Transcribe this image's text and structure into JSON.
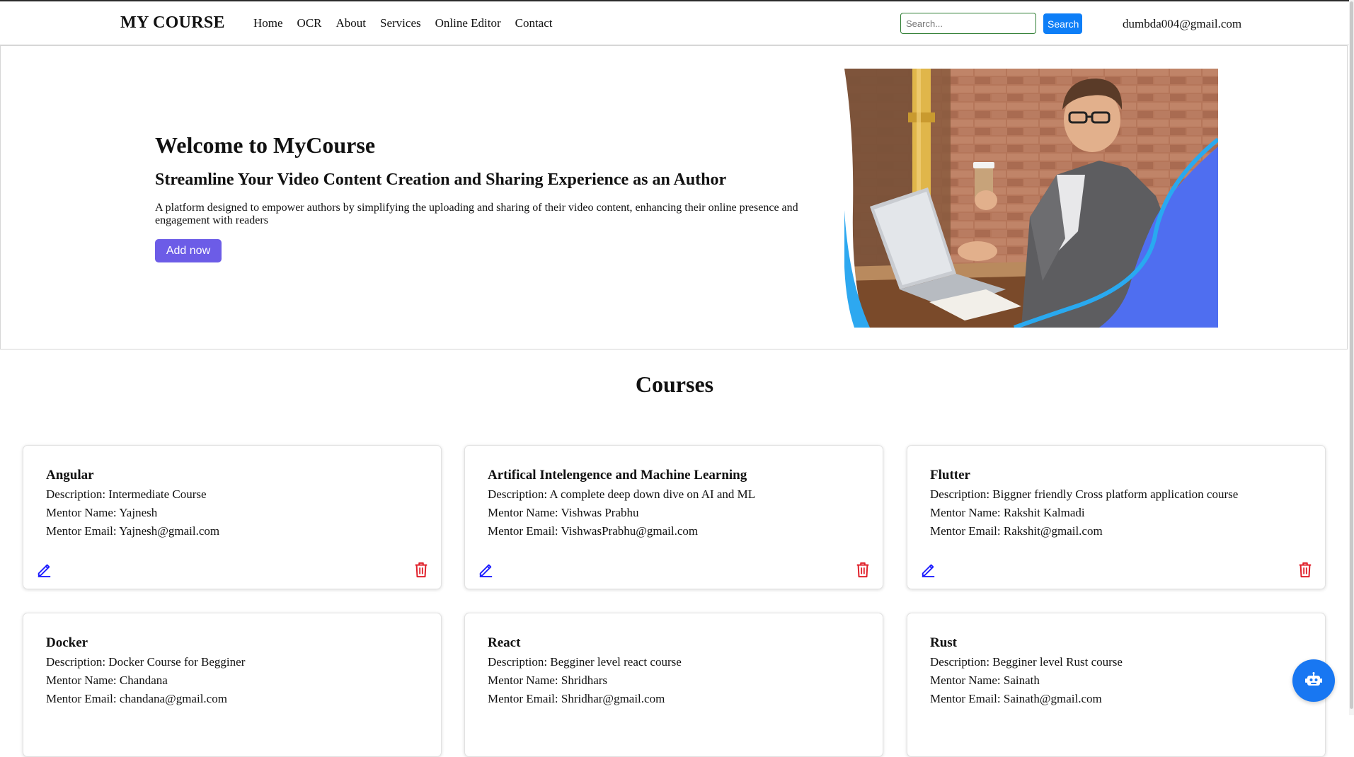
{
  "navbar": {
    "brand": "MY COURSE",
    "links": [
      "Home",
      "OCR",
      "About",
      "Services",
      "Online Editor",
      "Contact"
    ],
    "search_placeholder": "Search...",
    "search_button": "Search",
    "user_email": "dumbda004@gmail.com"
  },
  "hero": {
    "title": "Welcome to MyCourse",
    "subtitle": "Streamline Your Video Content Creation and Sharing Experience as an Author",
    "description": "A platform designed to empower authors by simplifying the uploading and sharing of their video content, enhancing their online presence and engagement with readers",
    "add_button": "Add now"
  },
  "courses": {
    "heading": "Courses",
    "items": [
      {
        "title": "Angular",
        "description": "Description: Intermediate Course",
        "mentor_name": "Mentor Name: Yajnesh",
        "mentor_email": "Mentor Email: Yajnesh@gmail.com"
      },
      {
        "title": "Artifical Intelengence and Machine Learning",
        "description": "Description: A complete deep down dive on AI and ML",
        "mentor_name": "Mentor Name: Vishwas Prabhu",
        "mentor_email": "Mentor Email: VishwasPrabhu@gmail.com"
      },
      {
        "title": "Flutter",
        "description": "Description: Biggner friendly Cross platform application course",
        "mentor_name": "Mentor Name: Rakshit Kalmadi",
        "mentor_email": "Mentor Email: Rakshit@gmail.com"
      },
      {
        "title": "Docker",
        "description": "Description: Docker Course for Begginer",
        "mentor_name": "Mentor Name: Chandana",
        "mentor_email": "Mentor Email: chandana@gmail.com"
      },
      {
        "title": "React",
        "description": "Description: Begginer level react course",
        "mentor_name": "Mentor Name: Shridhars",
        "mentor_email": "Mentor Email: Shridhar@gmail.com"
      },
      {
        "title": "Rust",
        "description": "Description: Begginer level Rust course",
        "mentor_name": "Mentor Name: Sainath",
        "mentor_email": "Mentor Email: Sainath@gmail.com"
      }
    ]
  },
  "colors": {
    "accent_purple": "#6c5ce7",
    "search_blue": "#0d7ef7",
    "edit_blue": "#1a1aff",
    "delete_red": "#e0212b",
    "chatbot_blue": "#1877f2"
  },
  "icons": {
    "edit": "pencil-icon",
    "delete": "trash-icon",
    "chatbot": "robot-icon"
  }
}
